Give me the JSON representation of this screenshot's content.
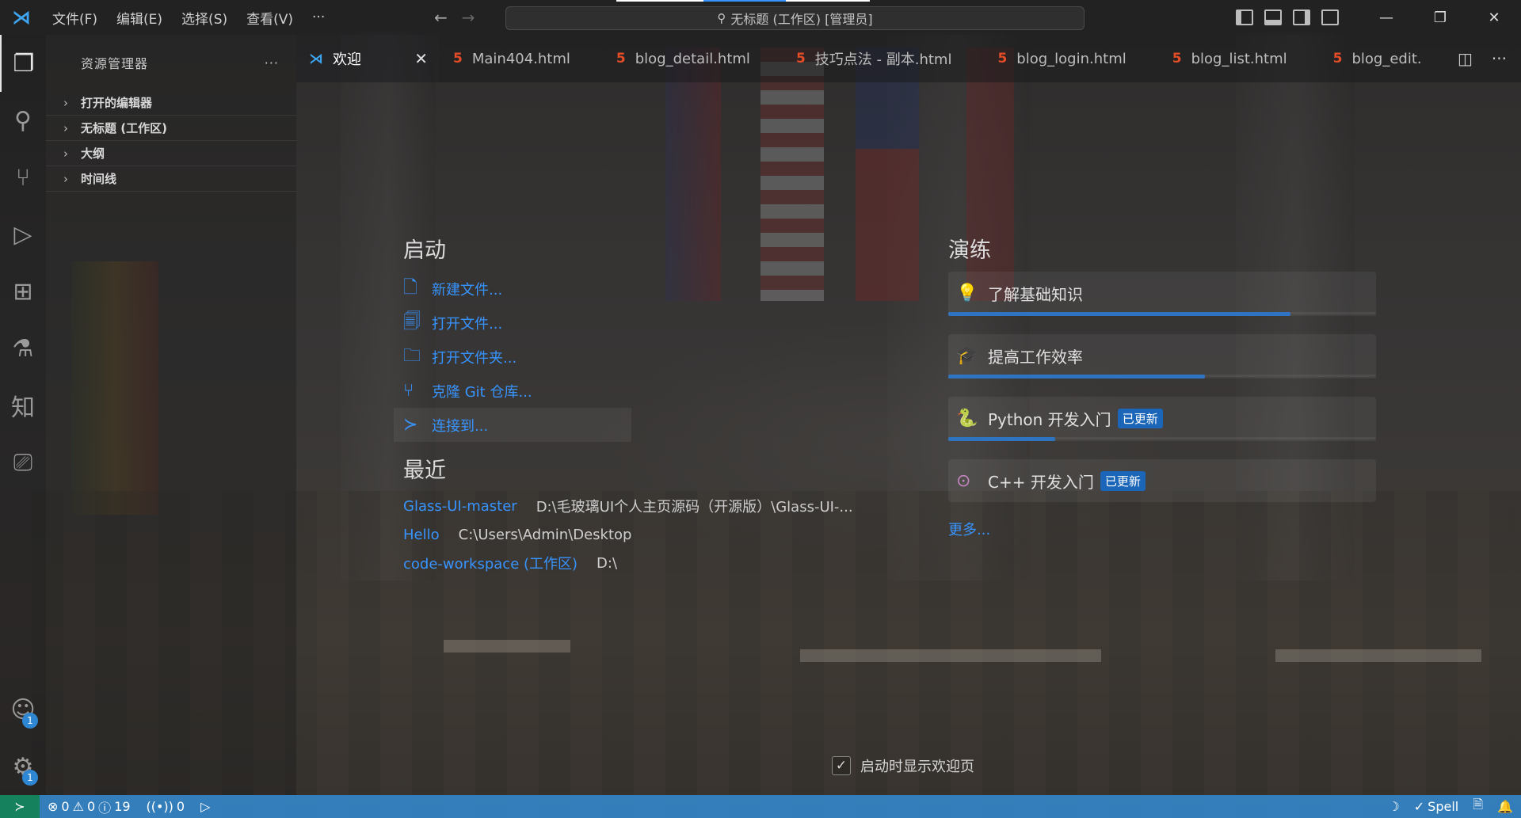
{
  "titlebar": {
    "menu": [
      "文件(F)",
      "编辑(E)",
      "选择(S)",
      "查看(V)"
    ],
    "more": "···",
    "command_center": "无标题 (工作区) [管理员]",
    "back_icon": "arrow-left-icon",
    "forward_icon": "arrow-right-icon",
    "window_controls": {
      "minimize": "—",
      "restore": "❐",
      "close": "✕"
    }
  },
  "activity_bar": {
    "items": [
      {
        "name": "explorer",
        "icon": "files-icon"
      },
      {
        "name": "search",
        "icon": "search-icon"
      },
      {
        "name": "source-control",
        "icon": "git-branch-icon"
      },
      {
        "name": "run-debug",
        "icon": "debug-icon"
      },
      {
        "name": "extensions",
        "icon": "extensions-icon"
      },
      {
        "name": "testing",
        "icon": "flask-icon"
      },
      {
        "name": "zhihu",
        "label": "知"
      },
      {
        "name": "remote-explorer",
        "icon": "remote-icon"
      }
    ],
    "accounts_badge": "1",
    "settings_badge": "1"
  },
  "sidebar": {
    "title": "资源管理器",
    "more": "···",
    "sections": [
      "打开的编辑器",
      "无标题 (工作区)",
      "大纲",
      "时间线"
    ]
  },
  "tabs": [
    {
      "label": "欢迎",
      "active": true
    },
    {
      "label": "Main404.html"
    },
    {
      "label": "blog_detail.html"
    },
    {
      "label": "技巧点法 - 副本.html"
    },
    {
      "label": "blog_login.html"
    },
    {
      "label": "blog_list.html"
    },
    {
      "label": "blog_edit."
    }
  ],
  "welcome": {
    "start": {
      "heading": "启动",
      "actions": [
        "新建文件...",
        "打开文件...",
        "打开文件夹...",
        "克隆 Git 仓库...",
        "连接到..."
      ]
    },
    "recent": {
      "heading": "最近",
      "items": [
        {
          "name": "Glass-UI-master",
          "path": "D:\\毛玻璃UI个人主页源码（开源版）\\Glass-UI-..."
        },
        {
          "name": "Hello",
          "path": "C:\\Users\\Admin\\Desktop"
        },
        {
          "name": "code-workspace (工作区)",
          "path": "D:\\"
        }
      ]
    },
    "walkthroughs": {
      "heading": "演练",
      "items": [
        {
          "label": "了解基础知识",
          "progress": 0.8,
          "icon": "lightbulb-icon"
        },
        {
          "label": "提高工作效率",
          "progress": 0.6,
          "icon": "mortarboard-icon"
        },
        {
          "label": "Python 开发入门",
          "badge": "已更新",
          "progress": 0.25,
          "icon": "python-icon"
        },
        {
          "label": "C++ 开发入门",
          "badge": "已更新",
          "progress": 0,
          "icon": "cpp-icon"
        }
      ],
      "more": "更多..."
    },
    "show_on_startup": "启动时显示欢迎页",
    "show_on_startup_checked": true
  },
  "statusbar": {
    "errors": "0",
    "warnings": "0",
    "infos": "19",
    "ports": "0",
    "spell": "Spell"
  },
  "colors": {
    "accent": "#3794ff",
    "statusbar": "#348cd4",
    "remote": "#16825d",
    "badge": "#1b66b8"
  }
}
